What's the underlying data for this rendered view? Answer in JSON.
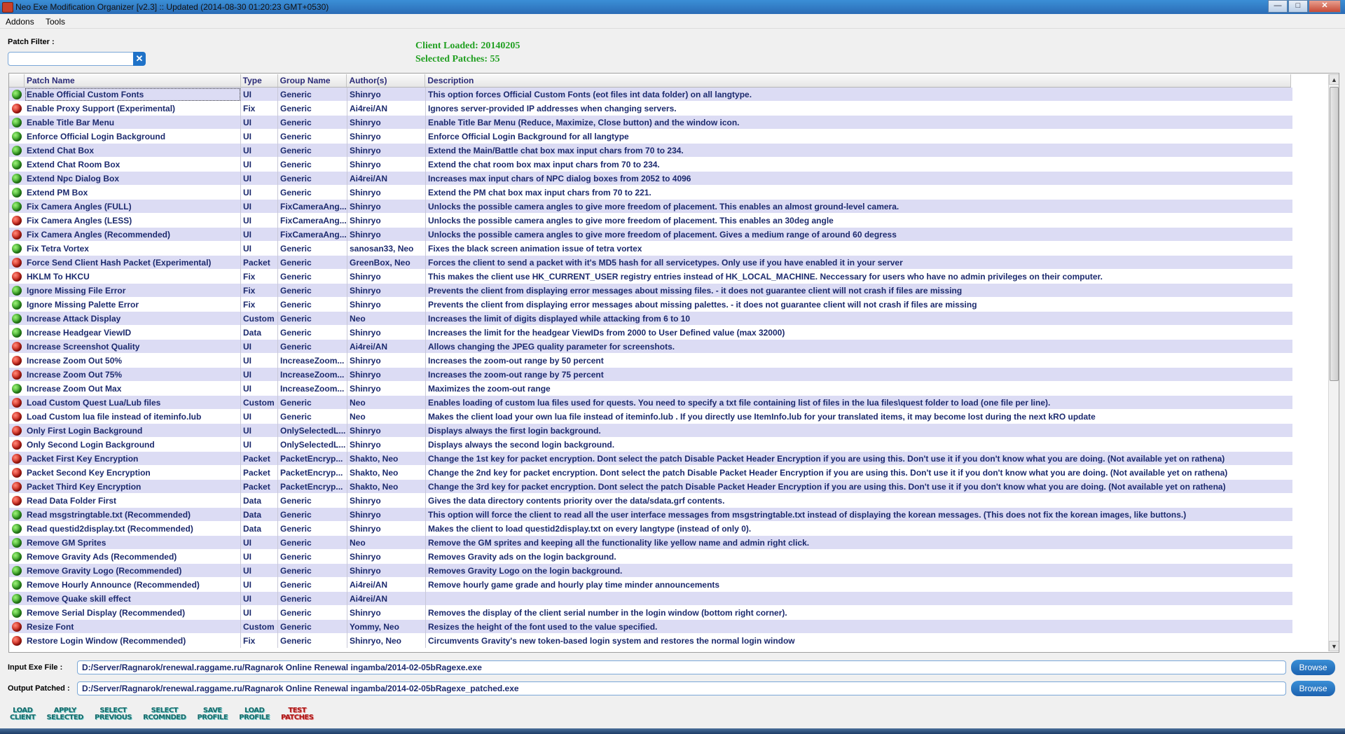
{
  "window": {
    "title": "Neo Exe Modification Organizer [v2.3]     ::    Updated (2014-08-30  01:20:23  GMT+0530)",
    "controls": {
      "minimize": "—",
      "maximize": "□",
      "close": "✕"
    }
  },
  "menu": [
    "Addons",
    "Tools"
  ],
  "filter": {
    "label": "Patch Filter :",
    "value": "",
    "clear_icon": "✕"
  },
  "status": {
    "client_loaded": "Client Loaded: 20140205",
    "selected_patches": "Selected Patches: 55"
  },
  "table": {
    "columns": [
      "Patch Name",
      "Type",
      "Group Name",
      "Author(s)",
      "Description"
    ],
    "rows": [
      {
        "on": true,
        "name": "Enable Official Custom Fonts",
        "type": "UI",
        "group": "Generic",
        "author": "Shinryo",
        "desc": "This option forces Official Custom Fonts (eot files int data folder) on all langtype."
      },
      {
        "on": false,
        "name": "Enable Proxy Support (Experimental)",
        "type": "Fix",
        "group": "Generic",
        "author": "Ai4rei/AN",
        "desc": "Ignores server-provided IP addresses when changing servers."
      },
      {
        "on": true,
        "name": "Enable Title Bar Menu",
        "type": "UI",
        "group": "Generic",
        "author": "Shinryo",
        "desc": "Enable Title Bar Menu (Reduce, Maximize, Close button) and the window icon."
      },
      {
        "on": true,
        "name": "Enforce Official Login Background",
        "type": "UI",
        "group": "Generic",
        "author": "Shinryo",
        "desc": "Enforce Official Login Background for all langtype"
      },
      {
        "on": true,
        "name": "Extend Chat Box",
        "type": "UI",
        "group": "Generic",
        "author": "Shinryo",
        "desc": "Extend the Main/Battle chat box max input chars from 70 to 234."
      },
      {
        "on": true,
        "name": "Extend Chat Room Box",
        "type": "UI",
        "group": "Generic",
        "author": "Shinryo",
        "desc": "Extend the chat room box max input chars from 70 to 234."
      },
      {
        "on": true,
        "name": "Extend Npc Dialog Box",
        "type": "UI",
        "group": "Generic",
        "author": "Ai4rei/AN",
        "desc": "Increases max input chars of NPC dialog boxes from 2052 to 4096"
      },
      {
        "on": true,
        "name": "Extend PM Box",
        "type": "UI",
        "group": "Generic",
        "author": "Shinryo",
        "desc": "Extend the PM chat box max input chars from 70 to 221."
      },
      {
        "on": true,
        "name": "Fix Camera Angles (FULL)",
        "type": "UI",
        "group": "FixCameraAng...",
        "author": "Shinryo",
        "desc": "Unlocks the possible camera angles to give more freedom of placement. This enables an almost ground-level camera."
      },
      {
        "on": false,
        "name": "Fix Camera Angles (LESS)",
        "type": "UI",
        "group": "FixCameraAng...",
        "author": "Shinryo",
        "desc": "Unlocks the possible camera angles to give more freedom of placement. This enables an 30deg angle"
      },
      {
        "on": false,
        "name": "Fix Camera Angles (Recommended)",
        "type": "UI",
        "group": "FixCameraAng...",
        "author": "Shinryo",
        "desc": "Unlocks the possible camera angles to give more freedom of placement. Gives a medium range of around 60 degress"
      },
      {
        "on": true,
        "name": "Fix Tetra Vortex",
        "type": "UI",
        "group": "Generic",
        "author": "sanosan33, Neo",
        "desc": "Fixes the black screen animation issue of tetra vortex"
      },
      {
        "on": false,
        "name": "Force Send Client Hash Packet (Experimental)",
        "type": "Packet",
        "group": "Generic",
        "author": "GreenBox, Neo",
        "desc": "Forces the client to send a packet with it's MD5 hash for all servicetypes. Only use if you have enabled it in your server"
      },
      {
        "on": false,
        "name": "HKLM To HKCU",
        "type": "Fix",
        "group": "Generic",
        "author": "Shinryo",
        "desc": "This makes the client use HK_CURRENT_USER registry entries instead of HK_LOCAL_MACHINE. Neccessary for users who have no admin privileges on their computer."
      },
      {
        "on": true,
        "name": "Ignore Missing File Error",
        "type": "Fix",
        "group": "Generic",
        "author": "Shinryo",
        "desc": "Prevents the client from displaying error messages about missing files. - it does not guarantee client will not crash if files are missing"
      },
      {
        "on": true,
        "name": "Ignore Missing Palette Error",
        "type": "Fix",
        "group": "Generic",
        "author": "Shinryo",
        "desc": "Prevents the client from displaying error messages about missing palettes. - it does not guarantee client will not crash if files are missing"
      },
      {
        "on": true,
        "name": "Increase Attack Display",
        "type": "Custom",
        "group": "Generic",
        "author": "Neo",
        "desc": "Increases the limit of digits displayed while attacking from 6 to 10"
      },
      {
        "on": true,
        "name": "Increase Headgear ViewID",
        "type": "Data",
        "group": "Generic",
        "author": "Shinryo",
        "desc": "Increases the limit for the headgear ViewIDs from 2000 to User Defined value (max 32000)"
      },
      {
        "on": false,
        "name": "Increase Screenshot Quality",
        "type": "UI",
        "group": "Generic",
        "author": "Ai4rei/AN",
        "desc": "Allows changing the JPEG quality parameter for screenshots."
      },
      {
        "on": false,
        "name": "Increase Zoom Out 50%",
        "type": "UI",
        "group": "IncreaseZoom...",
        "author": "Shinryo",
        "desc": "Increases the zoom-out range by 50 percent"
      },
      {
        "on": false,
        "name": "Increase Zoom Out 75%",
        "type": "UI",
        "group": "IncreaseZoom...",
        "author": "Shinryo",
        "desc": "Increases the zoom-out range by 75 percent"
      },
      {
        "on": true,
        "name": "Increase Zoom Out Max",
        "type": "UI",
        "group": "IncreaseZoom...",
        "author": "Shinryo",
        "desc": "Maximizes the zoom-out range"
      },
      {
        "on": false,
        "name": "Load Custom Quest Lua/Lub files",
        "type": "Custom",
        "group": "Generic",
        "author": "Neo",
        "desc": "Enables loading of custom lua files used for quests. You need to specify a txt file containing list of files in the lua files\\quest folder to load (one file per line)."
      },
      {
        "on": false,
        "name": "Load Custom lua file instead of iteminfo.lub",
        "type": "UI",
        "group": "Generic",
        "author": "Neo",
        "desc": "Makes the client load your own lua file instead of iteminfo.lub . If you directly use ItemInfo.lub for your translated items, it may become lost during the next kRO update"
      },
      {
        "on": false,
        "name": "Only First Login Background",
        "type": "UI",
        "group": "OnlySelectedL...",
        "author": "Shinryo",
        "desc": "Displays always the first login background."
      },
      {
        "on": false,
        "name": "Only Second Login Background",
        "type": "UI",
        "group": "OnlySelectedL...",
        "author": "Shinryo",
        "desc": "Displays always the second login background."
      },
      {
        "on": false,
        "name": "Packet First Key Encryption",
        "type": "Packet",
        "group": "PacketEncryp...",
        "author": "Shakto, Neo",
        "desc": "Change the 1st key for packet encryption. Dont select the patch Disable Packet Header Encryption if you are using this. Don't use it if you don't know what you are doing. (Not available yet on rathena)"
      },
      {
        "on": false,
        "name": "Packet Second Key Encryption",
        "type": "Packet",
        "group": "PacketEncryp...",
        "author": "Shakto, Neo",
        "desc": "Change the 2nd key for packet encryption. Dont select the patch Disable Packet Header Encryption if you are using this. Don't use it if you don't know what you are doing. (Not available yet on rathena)"
      },
      {
        "on": false,
        "name": "Packet Third Key Encryption",
        "type": "Packet",
        "group": "PacketEncryp...",
        "author": "Shakto, Neo",
        "desc": "Change the 3rd key for packet encryption. Dont select the patch Disable Packet Header Encryption if you are using this. Don't use it if you don't know what you are doing. (Not available yet on rathena)"
      },
      {
        "on": false,
        "name": "Read Data Folder First",
        "type": "Data",
        "group": "Generic",
        "author": "Shinryo",
        "desc": "Gives the data directory contents priority over the data/sdata.grf contents."
      },
      {
        "on": true,
        "name": "Read msgstringtable.txt (Recommended)",
        "type": "Data",
        "group": "Generic",
        "author": "Shinryo",
        "desc": "This option will force the client to read all the user interface messages from  msgstringtable.txt instead of displaying the korean messages.  (This does not fix the korean images, like buttons.)"
      },
      {
        "on": true,
        "name": "Read questid2display.txt (Recommended)",
        "type": "Data",
        "group": "Generic",
        "author": "Shinryo",
        "desc": "Makes the client to load questid2display.txt on every langtype (instead of only 0)."
      },
      {
        "on": true,
        "name": "Remove GM Sprites",
        "type": "UI",
        "group": "Generic",
        "author": "Neo",
        "desc": "Remove the GM sprites and keeping all the functionality like yellow name and admin right click."
      },
      {
        "on": true,
        "name": "Remove Gravity Ads (Recommended)",
        "type": "UI",
        "group": "Generic",
        "author": "Shinryo",
        "desc": "Removes Gravity ads on the login background."
      },
      {
        "on": true,
        "name": "Remove Gravity Logo (Recommended)",
        "type": "UI",
        "group": "Generic",
        "author": "Shinryo",
        "desc": "Removes Gravity Logo on the login background."
      },
      {
        "on": true,
        "name": "Remove Hourly Announce (Recommended)",
        "type": "UI",
        "group": "Generic",
        "author": "Ai4rei/AN",
        "desc": "Remove hourly game grade and hourly play time minder announcements"
      },
      {
        "on": true,
        "name": "Remove Quake skill effect",
        "type": "UI",
        "group": "Generic",
        "author": "Ai4rei/AN",
        "desc": ""
      },
      {
        "on": true,
        "name": "Remove Serial Display (Recommended)",
        "type": "UI",
        "group": "Generic",
        "author": "Shinryo",
        "desc": "Removes the display of the client serial number in the login window (bottom right corner)."
      },
      {
        "on": false,
        "name": "Resize Font",
        "type": "Custom",
        "group": "Generic",
        "author": "Yommy, Neo",
        "desc": "Resizes the height of the font used to the value specified."
      },
      {
        "on": false,
        "name": "Restore Login Window (Recommended)",
        "type": "Fix",
        "group": "Generic",
        "author": "Shinryo, Neo",
        "desc": "Circumvents Gravity's new token-based login system and restores the normal login window"
      }
    ]
  },
  "scroll": {
    "up": "▲",
    "down": "▼"
  },
  "io": {
    "input_label": "Input Exe File :",
    "input_value": "D:/Server/Ragnarok/renewal.raggame.ru/Ragnarok Online Renewal ingamba/2014-02-05bRagexe.exe",
    "output_label": "Output Patched :",
    "output_value": "D:/Server/Ragnarok/renewal.raggame.ru/Ragnarok Online Renewal ingamba/2014-02-05bRagexe_patched.exe",
    "browse": "Browse"
  },
  "toolbar": [
    {
      "line1": "LOAD",
      "line2": "CLIENT",
      "color": "#1a6a6a"
    },
    {
      "line1": "APPLY",
      "line2": "SELECTED",
      "color": "#1a6a6a"
    },
    {
      "line1": "SELECT",
      "line2": "PREVIOUS",
      "color": "#1a6a6a"
    },
    {
      "line1": "SELECT",
      "line2": "RCOMNDED",
      "color": "#1a6a6a"
    },
    {
      "line1": "SAVE",
      "line2": "PROFILE",
      "color": "#1a6a6a"
    },
    {
      "line1": "LOAD",
      "line2": "PROFILE",
      "color": "#1a6a6a"
    },
    {
      "line1": "TEST",
      "line2": "PATCHES",
      "color": "#a81818"
    }
  ],
  "colors": {
    "accent": "#1f72c8",
    "status_green": "#22a022",
    "row_alt": "#dcdcf4",
    "text_rows": "#1c2a6e"
  }
}
